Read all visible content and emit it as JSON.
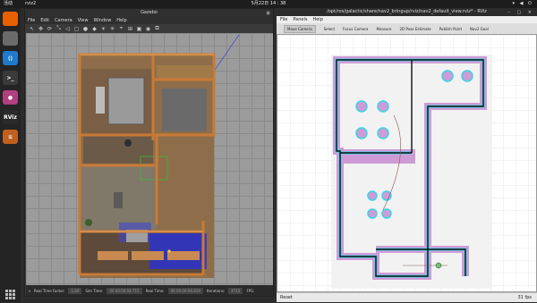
{
  "topbar": {
    "activities": "活动",
    "app": "rviz2",
    "clock": "5月22日  14 : 38",
    "sys": "▾ ◀ ⏻"
  },
  "dock": [
    {
      "name": "firefox-icon",
      "color": "#e66000",
      "label": ""
    },
    {
      "name": "files-icon",
      "color": "#6b6b6b",
      "label": ""
    },
    {
      "name": "vscode-icon",
      "color": "#1f7acc",
      "label": "⟨⟩"
    },
    {
      "name": "terminal-icon",
      "color": "#3a3a3a",
      "label": ">_"
    },
    {
      "name": "app-icon",
      "color": "#b04080",
      "label": "●"
    },
    {
      "name": "rviz-icon",
      "color": "#2a2a2a",
      "label": "RViz"
    },
    {
      "name": "layers-icon",
      "color": "#c06020",
      "label": "≡"
    }
  ],
  "gazebo": {
    "title": "Gazebo",
    "close": "×",
    "menu": [
      "File",
      "Edit",
      "Camera",
      "View",
      "Window",
      "Help"
    ],
    "tools": [
      "↖",
      "✥",
      "⟳",
      "⤡",
      "◁",
      "▢",
      "●",
      "◆",
      "☀",
      "✳",
      "⌖",
      "⊞",
      "▣",
      "◉",
      "⧉"
    ],
    "status": {
      "pause": "⏸",
      "rtf_label": "Real Time Factor:",
      "rtf": "1.00",
      "sim_label": "Sim Time:",
      "sim": "00 00:00:04.715",
      "real_label": "Real Time:",
      "real": "00 00:00:04.819",
      "iter_label": "Iterations:",
      "iter": "4715",
      "fps": "FPS:"
    }
  },
  "rviz": {
    "title": "/opt/ros/galactic/share/nav2_bringup/rviz/nav2_default_view.rviz* - RViz",
    "winctl": "– ▢ ×",
    "menu": [
      "File",
      "Panels",
      "Help"
    ],
    "tools": [
      "Move Camera",
      "Select",
      "Focus Camera",
      "Measure",
      "2D Pose Estimate",
      "Publish Point",
      "Nav2 Goal"
    ],
    "reset": "Reset",
    "fps": "31 fps"
  }
}
